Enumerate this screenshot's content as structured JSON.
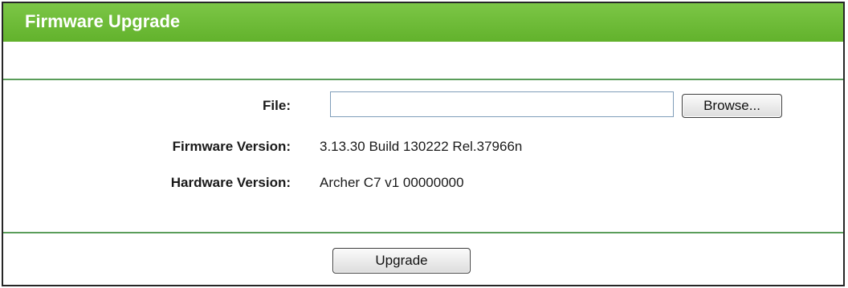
{
  "panel": {
    "title": "Firmware Upgrade"
  },
  "form": {
    "file_label": "File:",
    "file_value": "",
    "browse_label": "Browse...",
    "firmware_version_label": "Firmware Version:",
    "firmware_version_value": "3.13.30 Build 130222 Rel.37966n",
    "hardware_version_label": "Hardware Version:",
    "hardware_version_value": "Archer C7 v1 00000000",
    "upgrade_label": "Upgrade"
  },
  "colors": {
    "title_bar": "#6fbd3b",
    "divider": "#5a9d5a"
  }
}
